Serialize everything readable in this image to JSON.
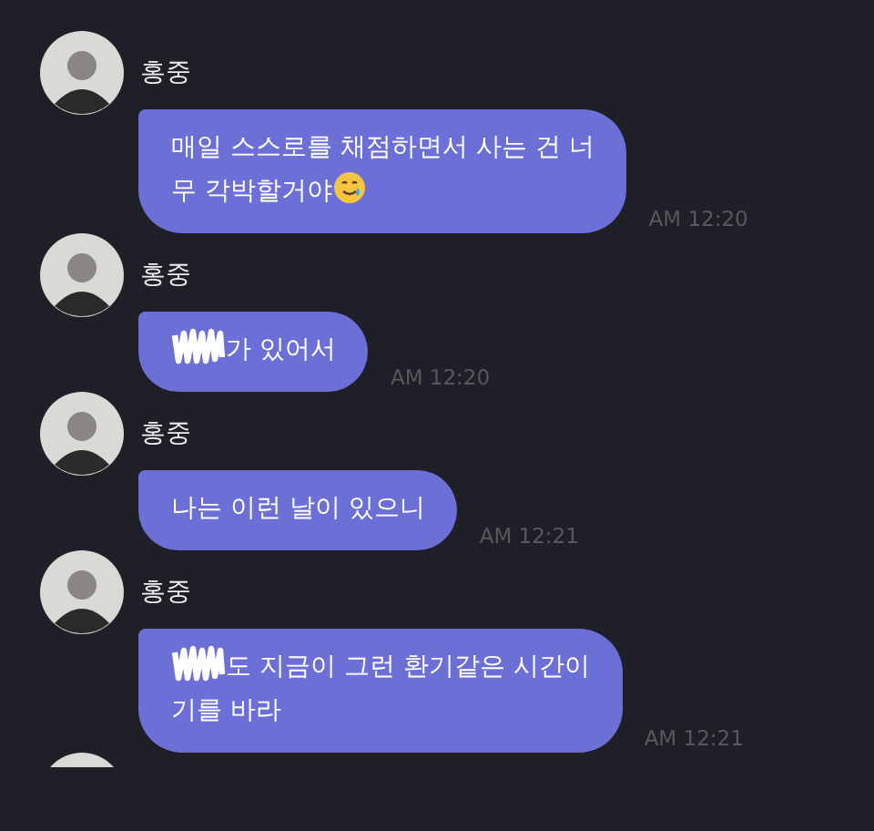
{
  "messages": [
    {
      "kind": "message",
      "sender": "홍중",
      "lines": [
        "매일 스스로를 채점하면서 사는 건 너",
        "무 각박할거야"
      ],
      "redacted_prefix": false,
      "tear_smile_emoji": true,
      "time": "AM 12:20"
    },
    {
      "kind": "message",
      "sender": "홍중",
      "lines": [
        "가 있어서"
      ],
      "redacted_prefix": true,
      "tear_smile_emoji": false,
      "time": "AM 12:20"
    },
    {
      "kind": "message",
      "sender": "홍중",
      "lines": [
        "나는 이런 날이 있으니"
      ],
      "redacted_prefix": false,
      "tear_smile_emoji": false,
      "time": "AM 12:21"
    },
    {
      "kind": "message",
      "sender": "홍중",
      "lines": [
        "도 지금이 그런 환기같은 시간이",
        "기를 바라"
      ],
      "redacted_prefix": true,
      "tear_smile_emoji": false,
      "time": "AM 12:21"
    },
    {
      "kind": "cut"
    }
  ]
}
